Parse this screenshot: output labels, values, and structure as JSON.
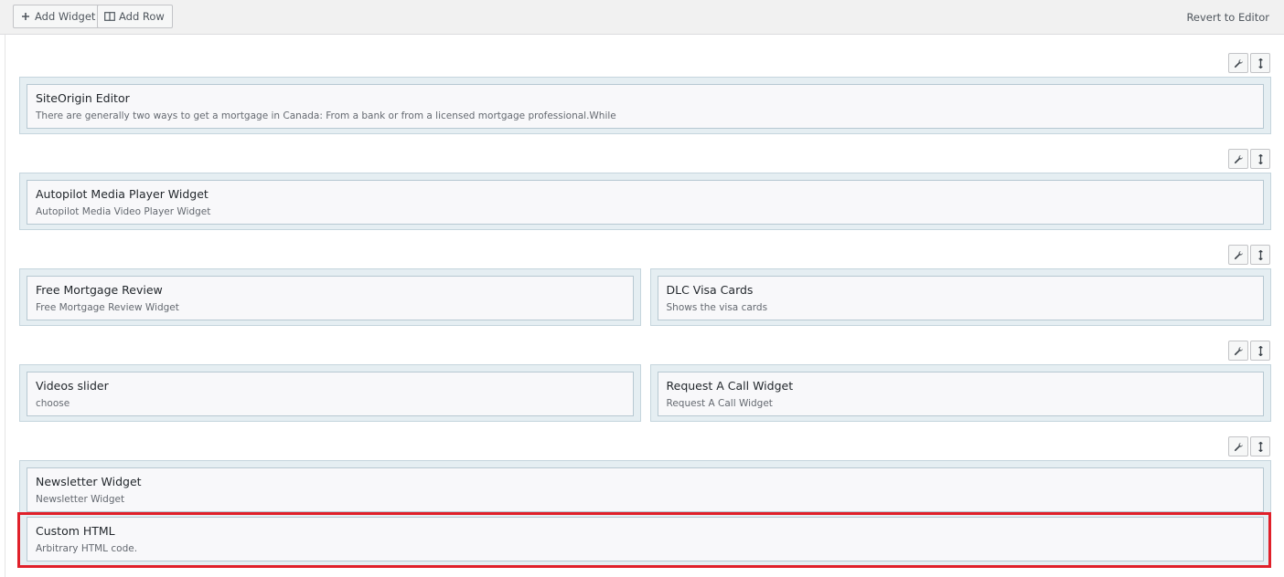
{
  "toolbar": {
    "add_widget_label": "Add Widget",
    "add_row_label": "Add Row",
    "revert_label": "Revert to Editor"
  },
  "rows": [
    {
      "cells": [
        {
          "widgets": [
            {
              "title": "SiteOrigin Editor",
              "description": "There are generally two ways to get a mortgage in Canada: From a bank or from a licensed mortgage professional.While"
            }
          ]
        }
      ]
    },
    {
      "cells": [
        {
          "widgets": [
            {
              "title": "Autopilot Media Player Widget",
              "description": "Autopilot Media Video Player Widget"
            }
          ]
        }
      ]
    },
    {
      "cells": [
        {
          "widgets": [
            {
              "title": "Free Mortgage Review",
              "description": "Free Mortgage Review Widget"
            }
          ]
        },
        {
          "widgets": [
            {
              "title": "DLC Visa Cards",
              "description": "Shows the visa cards"
            }
          ]
        }
      ]
    },
    {
      "cells": [
        {
          "widgets": [
            {
              "title": "Videos slider",
              "description": "choose"
            }
          ]
        },
        {
          "widgets": [
            {
              "title": "Request A Call Widget",
              "description": "Request A Call Widget"
            }
          ]
        }
      ]
    },
    {
      "cells": [
        {
          "widgets": [
            {
              "title": "Newsletter Widget",
              "description": "Newsletter Widget"
            },
            {
              "title": "Custom HTML",
              "description": "Arbitrary HTML code."
            }
          ]
        }
      ]
    }
  ],
  "colors": {
    "highlight": "#e0202a",
    "cell_bg": "#e5eef2",
    "widget_bg": "#f8f8fa"
  },
  "icons": {
    "add_widget": "plus-icon",
    "add_row": "columns-icon",
    "row_edit": "wrench-icon",
    "row_move": "move-vertical-icon"
  }
}
